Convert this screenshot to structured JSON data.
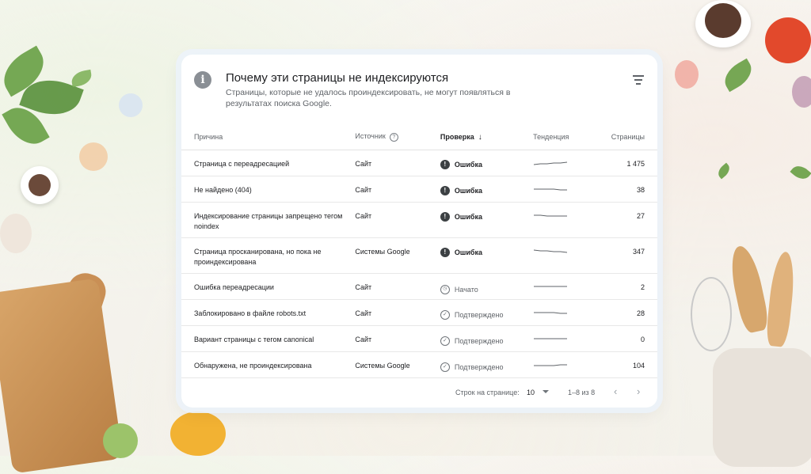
{
  "header": {
    "title": "Почему эти страницы не индексируются",
    "subtitle": "Страницы, которые не удалось проиндексировать, не могут появляться в результатах поиска Google."
  },
  "table": {
    "columns": {
      "reason": "Причина",
      "source": "Источник",
      "validation": "Проверка",
      "trend": "Тенденция",
      "pages": "Страницы"
    },
    "rows": [
      {
        "reason": "Страница с переадресацией",
        "source": "Сайт",
        "status": "Ошибка",
        "status_type": "error",
        "pages": "1 475",
        "trend": [
          3,
          4,
          4,
          5,
          5,
          6
        ]
      },
      {
        "reason": "Не найдено (404)",
        "source": "Сайт",
        "status": "Ошибка",
        "status_type": "error",
        "pages": "38",
        "trend": [
          5,
          5,
          5,
          5,
          4,
          4
        ]
      },
      {
        "reason": "Индексирование страницы запрещено тегом noindex",
        "source": "Сайт",
        "status": "Ошибка",
        "status_type": "error",
        "pages": "27",
        "trend": [
          5,
          5,
          4,
          4,
          4,
          4
        ]
      },
      {
        "reason": "Страница просканирована, но пока не проиндексирована",
        "source": "Системы Google",
        "status": "Ошибка",
        "status_type": "error",
        "pages": "347",
        "trend": [
          6,
          5,
          5,
          4,
          4,
          3
        ]
      },
      {
        "reason": "Ошибка переадресации",
        "source": "Сайт",
        "status": "Начато",
        "status_type": "started",
        "pages": "2",
        "trend": [
          5,
          5,
          5,
          5,
          5,
          5
        ]
      },
      {
        "reason": "Заблокировано в файле robots.txt",
        "source": "Сайт",
        "status": "Подтверждено",
        "status_type": "passed",
        "pages": "28",
        "trend": [
          5,
          5,
          5,
          5,
          4,
          4
        ]
      },
      {
        "reason": "Вариант страницы с тегом canonical",
        "source": "Сайт",
        "status": "Подтверждено",
        "status_type": "passed",
        "pages": "0",
        "trend": [
          5,
          5,
          5,
          5,
          5,
          5
        ]
      },
      {
        "reason": "Обнаружена, не проиндексирована",
        "source": "Системы Google",
        "status": "Подтверждено",
        "status_type": "passed",
        "pages": "104",
        "trend": [
          4,
          4,
          4,
          4,
          5,
          5
        ]
      }
    ]
  },
  "footer": {
    "rows_per_page_label": "Строк на странице:",
    "rows_per_page_value": "10",
    "range": "1–8 из 8"
  },
  "colors": {
    "error_icon": "#3c4043",
    "muted_icon": "#6f7479",
    "sparkline": "#5f6368"
  },
  "icons": {
    "info": "info-icon",
    "filter": "filter-icon",
    "help": "help-icon",
    "sort": "arrow-down-icon",
    "error": "exclamation-circle-icon",
    "started": "clock-icon",
    "passed": "check-circle-icon",
    "prev": "chevron-left-icon",
    "next": "chevron-right-icon"
  }
}
